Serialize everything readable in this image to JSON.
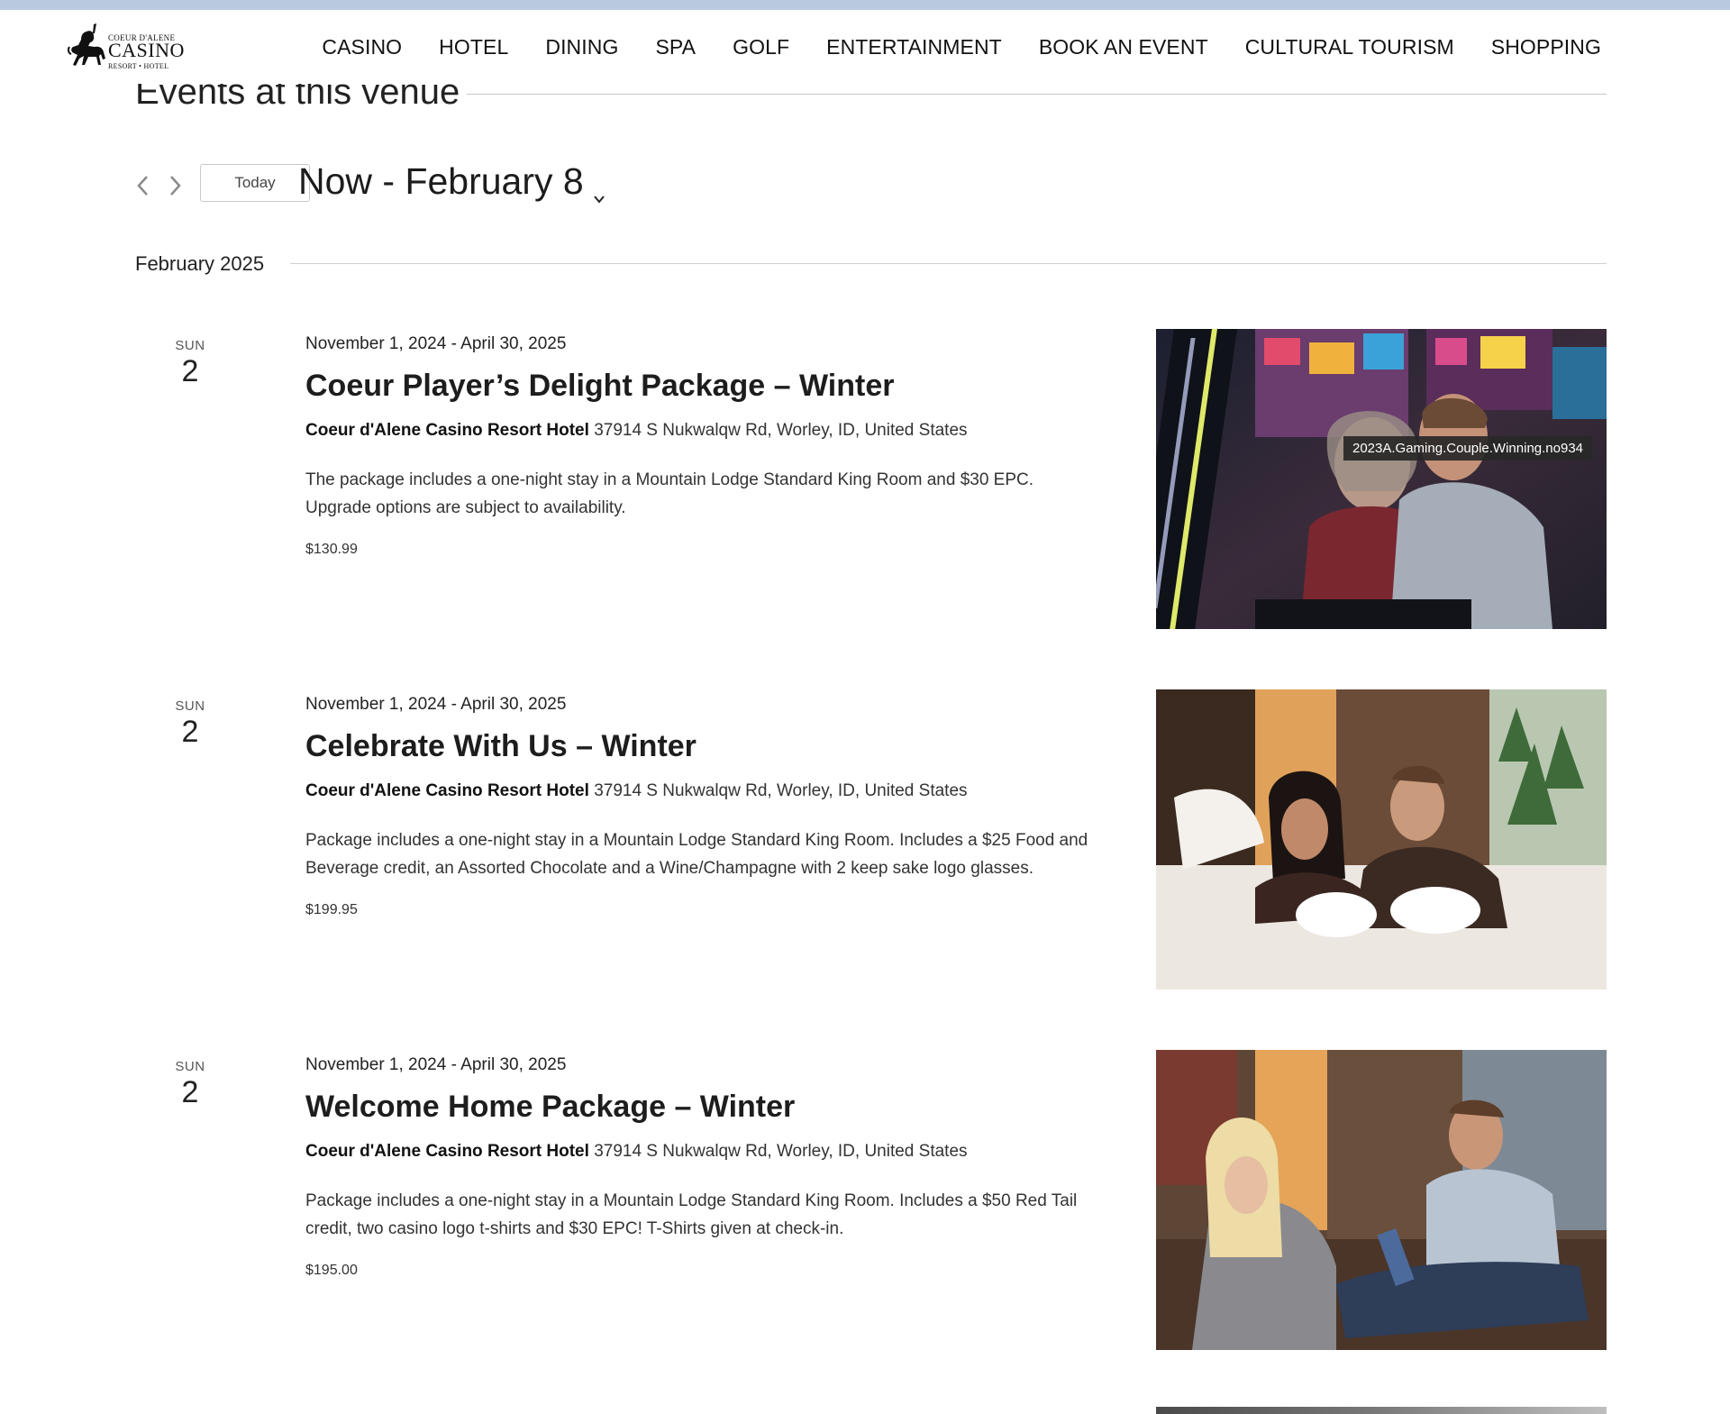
{
  "logo": {
    "line1": "COEUR D'ALENE",
    "line2": "CASINO",
    "line3": "RESORT • HOTEL"
  },
  "nav": [
    {
      "label": "CASINO"
    },
    {
      "label": "HOTEL"
    },
    {
      "label": "DINING"
    },
    {
      "label": "SPA"
    },
    {
      "label": "GOLF"
    },
    {
      "label": "ENTERTAINMENT"
    },
    {
      "label": "BOOK AN EVENT"
    },
    {
      "label": "CULTURAL TOURISM"
    },
    {
      "label": "SHOPPING"
    }
  ],
  "section_title": "Events at this venue",
  "date_nav": {
    "prev_icon": "chevron-left-icon",
    "next_icon": "chevron-right-icon",
    "today_label": "Today",
    "range_label": "Now - February 8"
  },
  "month_label": "February 2025",
  "events": [
    {
      "dow": "SUN",
      "day": "2",
      "dates": "November 1, 2024 - April 30, 2025",
      "title": "Coeur Player’s Delight Package – Winter",
      "venue_name": "Coeur d'Alene Casino Resort Hotel",
      "venue_address": "37914 S Nukwalqw Rd, Worley, ID, United States",
      "description": "The package includes a one-night stay in a Mountain Lodge Standard King Room and $30 EPC. Upgrade options are subject to availability.",
      "price": "$130.99"
    },
    {
      "dow": "SUN",
      "day": "2",
      "dates": "November 1, 2024 - April 30, 2025",
      "title": "Celebrate With Us – Winter",
      "venue_name": "Coeur d'Alene Casino Resort Hotel",
      "venue_address": "37914 S Nukwalqw Rd, Worley, ID, United States",
      "description": "Package includes a one-night stay in a Mountain Lodge Standard King Room. Includes a $25 Food and Beverage credit, an Assorted Chocolate and a Wine/Champagne with 2 keep sake logo glasses.",
      "price": "$199.95"
    },
    {
      "dow": "SUN",
      "day": "2",
      "dates": "November 1, 2024 - April 30, 2025",
      "title": "Welcome Home Package – Winter",
      "venue_name": "Coeur d'Alene Casino Resort Hotel",
      "venue_address": "37914 S Nukwalqw Rd, Worley, ID, United States",
      "description": "Package includes a one-night stay in a Mountain Lodge Standard King Room. Includes a $50 Red Tail credit, two casino logo t-shirts and $30 EPC! T-Shirts given at check-in.",
      "price": "$195.00"
    }
  ],
  "image_tooltip": "2023A.Gaming.Couple.Winning.no934"
}
